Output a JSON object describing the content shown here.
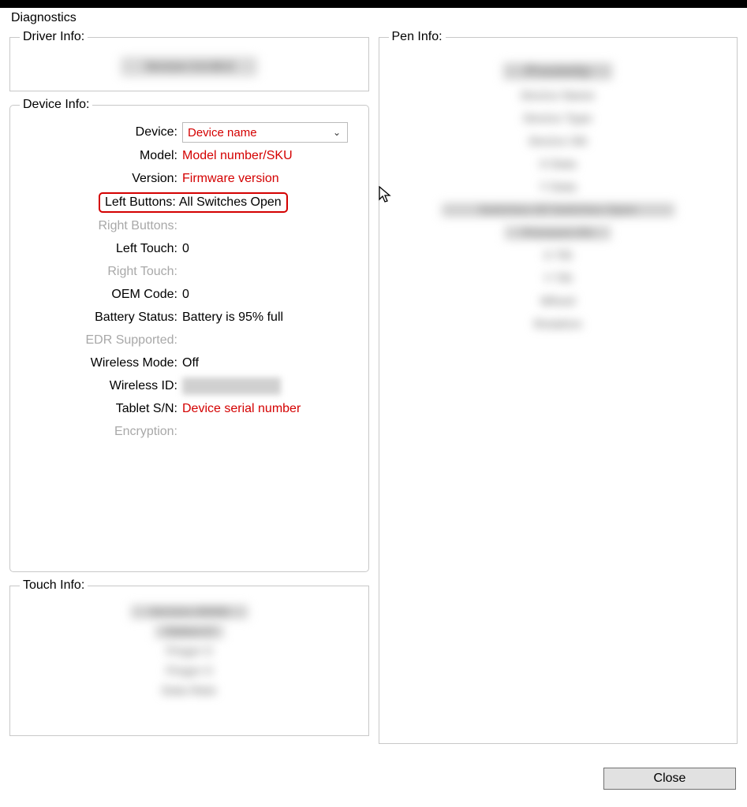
{
  "window": {
    "title": "Diagnostics"
  },
  "driver": {
    "legend": "Driver Info:"
  },
  "device": {
    "legend": "Device Info:",
    "rows": {
      "device": {
        "label": "Device:",
        "value": "Device name"
      },
      "model": {
        "label": "Model:",
        "value": "Model number/SKU"
      },
      "version": {
        "label": "Version:",
        "value": "Firmware version"
      },
      "leftButtons": {
        "label": "Left Buttons:",
        "value": "All Switches Open"
      },
      "rightButtons": {
        "label": "Right Buttons:",
        "value": ""
      },
      "leftTouch": {
        "label": "Left Touch:",
        "value": "0"
      },
      "rightTouch": {
        "label": "Right Touch:",
        "value": ""
      },
      "oemCode": {
        "label": "OEM Code:",
        "value": "0"
      },
      "batteryStatus": {
        "label": "Battery Status:",
        "value": "Battery is 95% full"
      },
      "edr": {
        "label": "EDR Supported:",
        "value": ""
      },
      "wirelessMode": {
        "label": "Wireless Mode:",
        "value": "Off"
      },
      "wirelessId": {
        "label": "Wireless ID:",
        "value": ""
      },
      "tabletSn": {
        "label": "Tablet S/N:",
        "value": "Device serial number"
      },
      "encryption": {
        "label": "Encryption:",
        "value": ""
      }
    }
  },
  "pen": {
    "legend": "Pen Info:"
  },
  "touch": {
    "legend": "Touch Info:"
  },
  "buttons": {
    "close": "Close"
  }
}
